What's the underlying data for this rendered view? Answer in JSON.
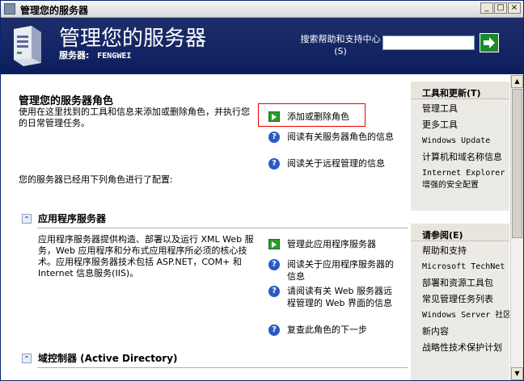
{
  "window": {
    "title": "管理您的服务器"
  },
  "header": {
    "title": "管理您的服务器",
    "server_label": "服务器:",
    "server_name": "FENGWEI",
    "search_label": "搜索帮助和支持中心(S)"
  },
  "main": {
    "heading": "管理您的服务器角色",
    "intro": "使用在这里找到的工具和信息来添加或删除角色，并执行您的日常管理任务。",
    "links": [
      "添加或删除角色",
      "阅读有关服务器角色的信息",
      "阅读关于远程管理的信息"
    ],
    "configured_text": "您的服务器已经用下列角色进行了配置:",
    "sections": [
      {
        "title": "应用程序服务器",
        "description": "应用程序服务器提供构造、部署以及运行 XML Web 服务，Web 应用程序和分布式应用程序所必须的核心技术。应用程序服务器技术包括 ASP.NET，COM+ 和 Internet 信息服务(IIS)。",
        "links": [
          "管理此应用程序服务器",
          "阅读关于应用程序服务器的信息",
          "请阅读有关 Web 服务器远程管理的 Web 界面的信息",
          "复查此角色的下一步"
        ]
      },
      {
        "title": "域控制器 (Active Directory)"
      }
    ]
  },
  "sidebar": {
    "tools": {
      "title": "工具和更新(T)",
      "items": [
        "管理工具",
        "更多工具",
        "Windows Update",
        "计算机和域名称信息",
        "Internet Explorer 增强的安全配置"
      ]
    },
    "see_also": {
      "title": "请参阅(E)",
      "items": [
        "帮助和支持",
        "Microsoft TechNet",
        "部署和资源工具包",
        "常见管理任务列表",
        "Windows Server 社区",
        "新内容",
        "战略性技术保护计划"
      ]
    }
  },
  "colors": {
    "header_bg": "#0b1e5c",
    "accent_green": "#2a9a2a",
    "highlight_red": "#e00000"
  }
}
